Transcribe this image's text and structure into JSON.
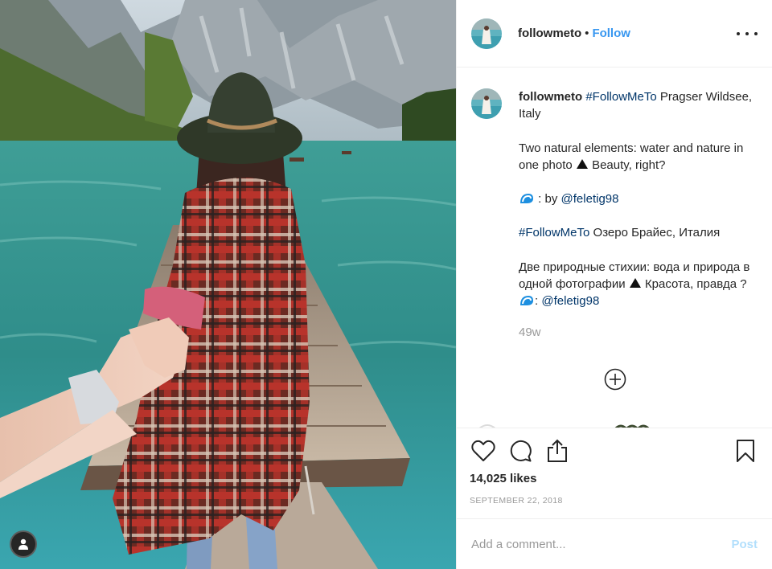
{
  "header": {
    "username": "followmeto",
    "separator": "•",
    "follow_label": "Follow",
    "more_icon": "more-dots-icon"
  },
  "caption": {
    "username": "followmeto",
    "hashtag_en": "#FollowMeTo",
    "location_en": "Pragser Wildsee, Italy",
    "text_en": "Two natural elements: water and nature in one photo",
    "text_en_end": "Beauty, right?",
    "credit1_prefix": ": by",
    "credit1_handle": "@feletig98",
    "hashtag_ru": "#FollowMeTo",
    "location_ru": "Озеро Брайес, Италия",
    "text_ru": "Две природные стихии: вода и природа в одной фотографии",
    "text_ru_end": "Красота, правда ?",
    "credit2_prefix": ":",
    "credit2_handle": "@feletig98",
    "age": "49w"
  },
  "actions": {
    "like_icon": "heart-icon",
    "comment_icon": "comment-icon",
    "share_icon": "share-icon",
    "save_icon": "bookmark-icon",
    "load_more_icon": "plus-circle-icon"
  },
  "likes_text": "14,025 likes",
  "date_text": "SEPTEMBER 22, 2018",
  "comment_box": {
    "placeholder": "Add a comment...",
    "post_label": "Post"
  },
  "colors": {
    "link": "#3897f0",
    "hashtag": "#003569",
    "muted": "#999999",
    "post_disabled": "#b2dffc",
    "text": "#262626"
  }
}
